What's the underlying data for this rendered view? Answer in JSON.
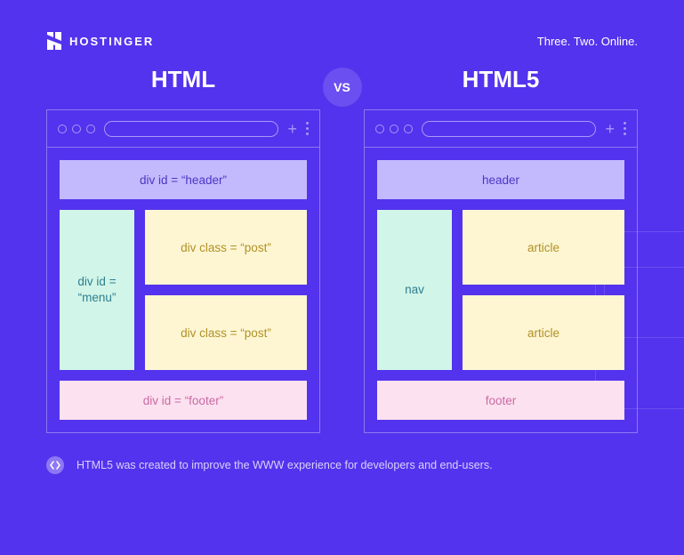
{
  "brand": {
    "name": "HOSTINGER",
    "tagline": "Three. Two. Online."
  },
  "vs_label": "VS",
  "columns": {
    "left": {
      "title": "HTML",
      "header": "div id = “header”",
      "nav": "div id = “menu”",
      "posts": [
        "div class = “post”",
        "div class = “post”"
      ],
      "footer": "div id = “footer”"
    },
    "right": {
      "title": "HTML5",
      "header": "header",
      "nav": "nav",
      "posts": [
        "article",
        "article"
      ],
      "footer": "footer"
    }
  },
  "footnote": "HTML5 was created to improve the WWW experience for developers and end-users."
}
